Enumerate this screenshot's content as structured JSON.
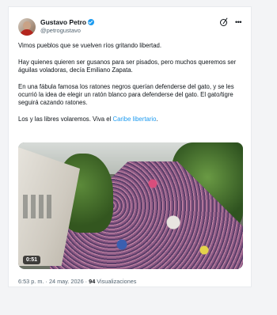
{
  "author": {
    "name": "Gustavo Petro",
    "handle": "@petrogustavo"
  },
  "icons": {
    "avatar": "profile-photo",
    "verified": "verified-badge-icon",
    "grok": "grok-icon",
    "more": "more-options-icon"
  },
  "post": {
    "p1": "Vimos pueblos que se vuelven ríos gritando libertad.",
    "p2": "Hay quienes quieren ser gusanos para ser pisados, pero muchos queremos ser águilas voladoras, decía Emiliano Zapata.",
    "p3": "En una fábula famosa los ratones negros querían defenderse del gato, y se les ocurrió la idea de elegir un ratón blanco para defenderse del gato. El gato/tigre seguirá cazando ratones.",
    "p4_prefix": "Los y las libres volaremos. Viva el ",
    "p4_link": "Caribe libertario",
    "p4_suffix": "."
  },
  "video": {
    "duration": "0:51"
  },
  "meta": {
    "time": "6:53 p. m.",
    "separator": " · ",
    "date": "24 may. 2026",
    "views_count": "94",
    "views_label": " Visualizaciones"
  },
  "colors": {
    "accent": "#1d9bf0",
    "text": "#0f1419",
    "muted": "#536471"
  }
}
